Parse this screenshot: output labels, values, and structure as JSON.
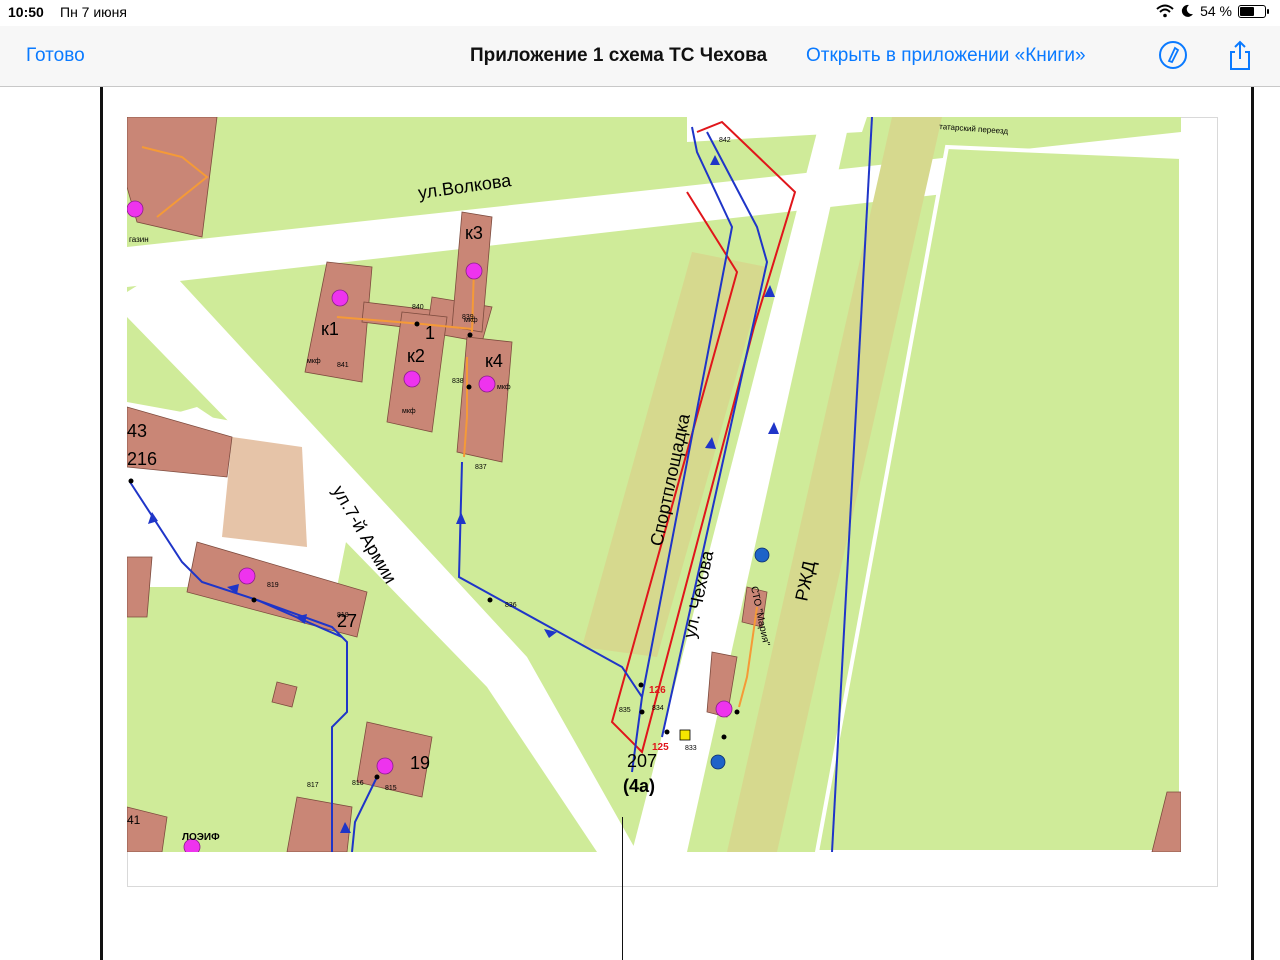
{
  "status": {
    "time": "10:50",
    "date": "Пн 7 июня",
    "battery": "54 %",
    "battery_level": 0.54
  },
  "nav": {
    "done": "Готово",
    "title": "Приложение 1 схема ТС Чехова",
    "open_in": "Открыть в приложении «Книги»"
  },
  "icons": {
    "markup": "markup-pen-icon",
    "share": "share-icon",
    "wifi": "wifi-icon",
    "moon": "moon-icon",
    "battery": "battery-icon"
  },
  "map": {
    "streets": {
      "volkova": "ул.Волкова",
      "armii": "ул.7-й Армии",
      "chekhova": "ул. Чехова",
      "rzd": "РЖД",
      "pereezd": "татарский переезд"
    },
    "places": {
      "sport": "Спортплощадка",
      "sto": "СТО \"Мария\"",
      "loeif": "ЛОЭИФ",
      "magazin": "газин"
    },
    "buildings": {
      "k1": "к1",
      "k2": "к2",
      "k3": "к3",
      "k4": "к4",
      "n1": "1",
      "b216": "216",
      "b43": "43",
      "b27": "27",
      "b19": "19",
      "b207": "207",
      "b4a": "(4а)",
      "b41": "41"
    },
    "marks": {
      "mkd": "мкф"
    },
    "nodes": {
      "n842": "842",
      "n840": "840",
      "n839": "839",
      "n841": "841",
      "n838": "838",
      "n837": "837",
      "n836": "836",
      "n819": "819",
      "n818": "818",
      "n817": "817",
      "n816": "816",
      "n815": "815",
      "n834": "834",
      "n835": "835",
      "n833": "833",
      "n126": "126",
      "n125": "125"
    }
  },
  "colors": {
    "accent": "#0a7aff",
    "grass": "#cfeb99",
    "building": "#c98676",
    "road": "#ffffff",
    "network": "#1f35c8",
    "boundary": "#e0161b",
    "pipe_orange": "#f59a37",
    "marker": "#ee33ee"
  }
}
